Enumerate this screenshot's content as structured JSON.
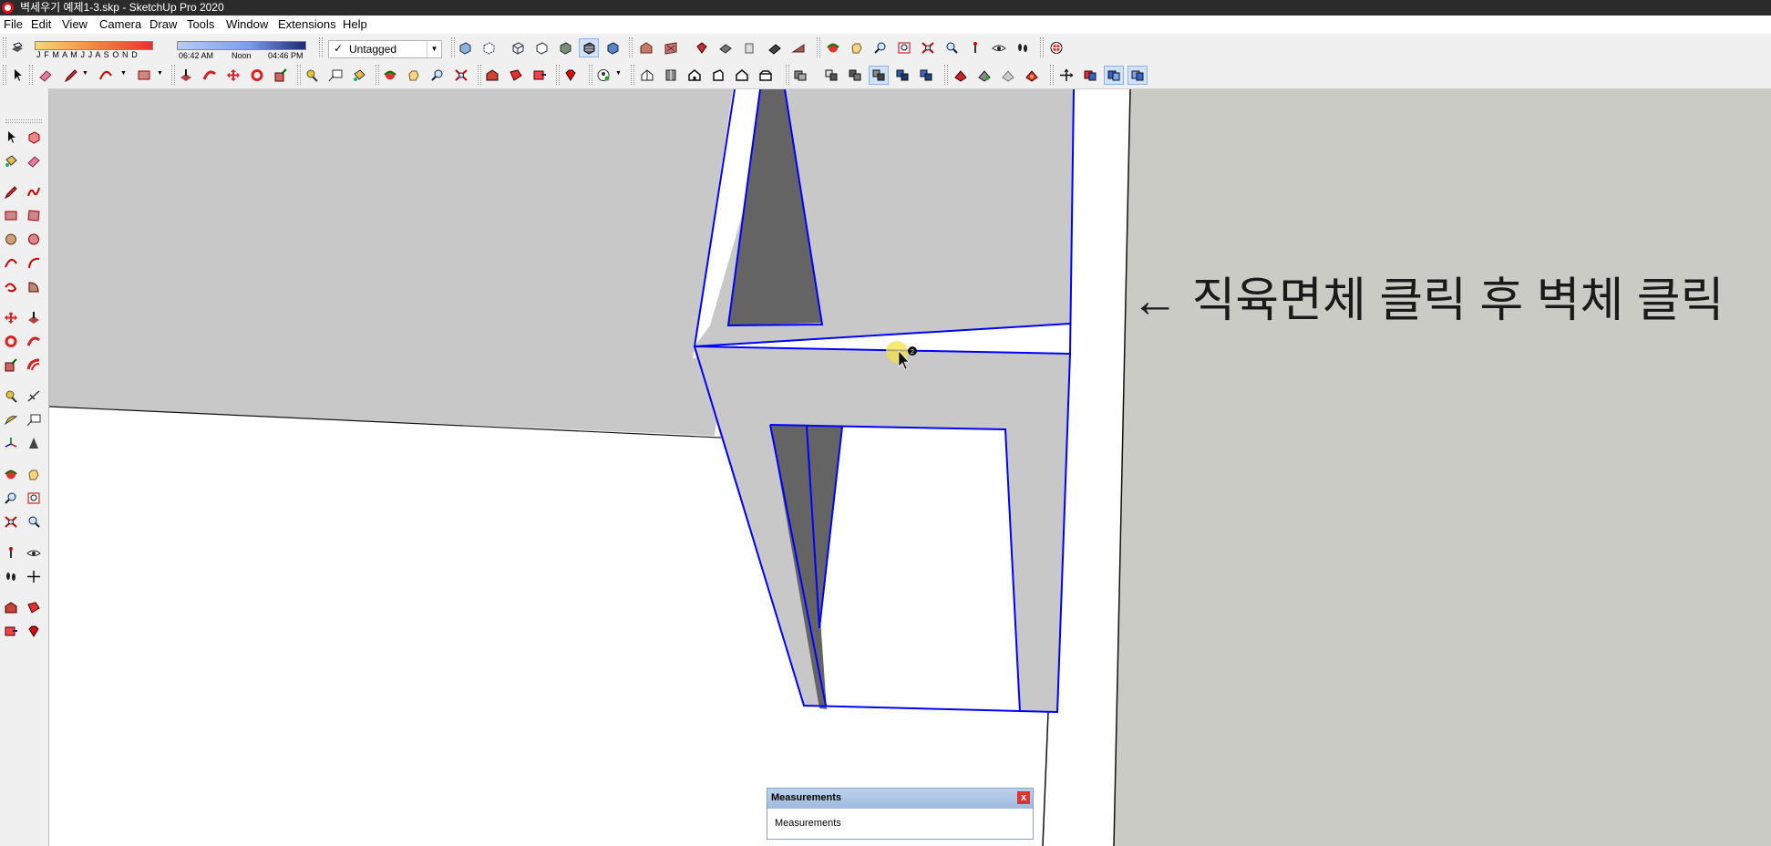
{
  "window": {
    "title": "벽세우기 예제1-3.skp - SketchUp Pro 2020"
  },
  "menu": [
    "File",
    "Edit",
    "View",
    "Camera",
    "Draw",
    "Tools",
    "Window",
    "Extensions",
    "Help"
  ],
  "shadows": {
    "months": "J F M A M J J A S O N D",
    "time_start": "06:42 AM",
    "time_mid": "Noon",
    "time_end": "04:46 PM"
  },
  "tags": {
    "check": "✓",
    "current": "Untagged"
  },
  "annotation": "← 직육면체 클릭 후 벽체 클릭",
  "cursor": {
    "badge": "2"
  },
  "measurements": {
    "title": "Measurements",
    "close": "x",
    "label": "Measurements"
  },
  "colors": {
    "selection": "#0000ff",
    "face_light": "#c8c8c8",
    "face_dark": "#646464",
    "ground": "#cbcbc6"
  }
}
